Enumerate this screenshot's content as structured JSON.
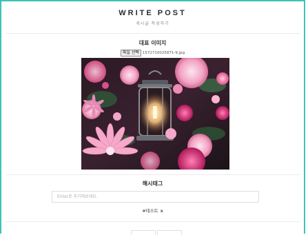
{
  "header": {
    "title": "WRITE POST",
    "subtitle": "게시글 작성하기"
  },
  "image_section": {
    "label": "대표 이미지",
    "file_button": "파일 선택",
    "file_name": "1572710025871-9.jpg"
  },
  "hashtag_section": {
    "label": "해시태그",
    "input_placeholder": "Enter로 추가해보세요.",
    "tags": [
      {
        "text": "#테스트",
        "remove": "x"
      }
    ]
  },
  "colors": {
    "accent_border": "#3cc4b4"
  }
}
